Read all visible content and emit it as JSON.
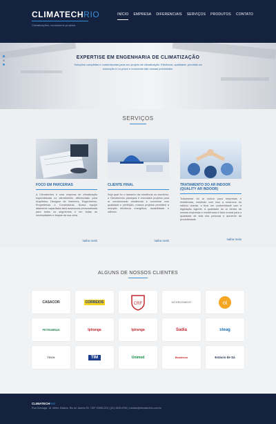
{
  "header": {
    "logo_main": "CLIMATECH",
    "logo_accent": "RIO",
    "tagline": "Climatizações, construindo projetos.",
    "nav": [
      "INÍCIO",
      "EMPRESA",
      "DIFERENCIAIS",
      "SERVIÇOS",
      "PRODUTOS",
      "CONTATO"
    ]
  },
  "hero": {
    "title": "EXPERTISE EM ENGENHARIA DE CLIMATIZAÇÃO",
    "subtitle": "Soluções completas e customizadas para seu projeto de climatização. Eficiência, qualidade, precisão na execução e no prazo e economia são nossas prioridades."
  },
  "services": {
    "title": "SERVIÇOS",
    "items": [
      {
        "title": "FOCO EM PARCERIAS",
        "text": "A Climatechrio é uma empresa de climatização especializada no atendimento diferenciado para Arquitetos, Designer de Interiores, Engenheiros, Empreiteiras e Construtoras. Nossa equipe altamente capacitada dará assessoria personalizada para todos os segmentos e em todas as necessidades e etapas da sua obra.",
        "more": "saiba mais"
      },
      {
        "title": "CLIENTE FINAL",
        "text": "Seja qual for o tamanho da residência ou escritório, a Climatechrio planejará e executará projetos para ar condicionado residencial e comercial com qualidade e perfeição, nossos projetos permitem a redução eficiência energética, durabilidade e silêncio.",
        "more": "saiba mais"
      },
      {
        "title": "TRATAMENTO DO AR INDOOR (QUALITY AR INDOOR)",
        "text": "Tratamento do ar indoor para empresas e residências, existindo com isso a síndrome do edifício doente, o ficar em conformidade com a legislação vigente. A qualidade do ar dentro da nossas empresas e residências é fator crucial para a qualidade de vida dos pessoas e aumento da produtividade.",
        "more": "saiba mais"
      }
    ]
  },
  "clients": {
    "title": "ALGUNS DE NOSSOS CLIENTES",
    "items": [
      {
        "name": "CASACOR",
        "color": "#333333"
      },
      {
        "name": "CORREIOS",
        "color": "#1a3c8c"
      },
      {
        "name": "FLAMENGO",
        "color": "#c0262d"
      },
      {
        "name": "INTERCEMENT",
        "color": "#666666"
      },
      {
        "name": "Oi",
        "color": "#f5a623"
      },
      {
        "name": "PETROBRAS",
        "color": "#0a7a35"
      },
      {
        "name": "Ipiranga",
        "color": "#c0262d"
      },
      {
        "name": "Ipiranga",
        "color": "#c0262d"
      },
      {
        "name": "Sadia",
        "color": "#c0262d"
      },
      {
        "name": "steag",
        "color": "#1a6fb0"
      },
      {
        "name": "TECH",
        "color": "#555555"
      },
      {
        "name": "TIM",
        "color": "#1a3c8c"
      },
      {
        "name": "Unimed",
        "color": "#0a8a3c"
      },
      {
        "name": "Bradesco",
        "color": "#c0262d"
      },
      {
        "name": "Estácio de Sá",
        "color": "#1d2b4a"
      }
    ]
  },
  "footer": {
    "logo_main": "CLIMATECH",
    "logo_accent": "RIO",
    "address": "Rua Gonzaga, 15, Méier, Estácio, Rio de Janeiro RJ, CEP 20550-215 | (21) 3549-8700 | contato@climatechrio.com.br"
  },
  "colors": {
    "navy": "#14213f",
    "accent": "#3a8ed6",
    "link": "#2b6aa8"
  }
}
